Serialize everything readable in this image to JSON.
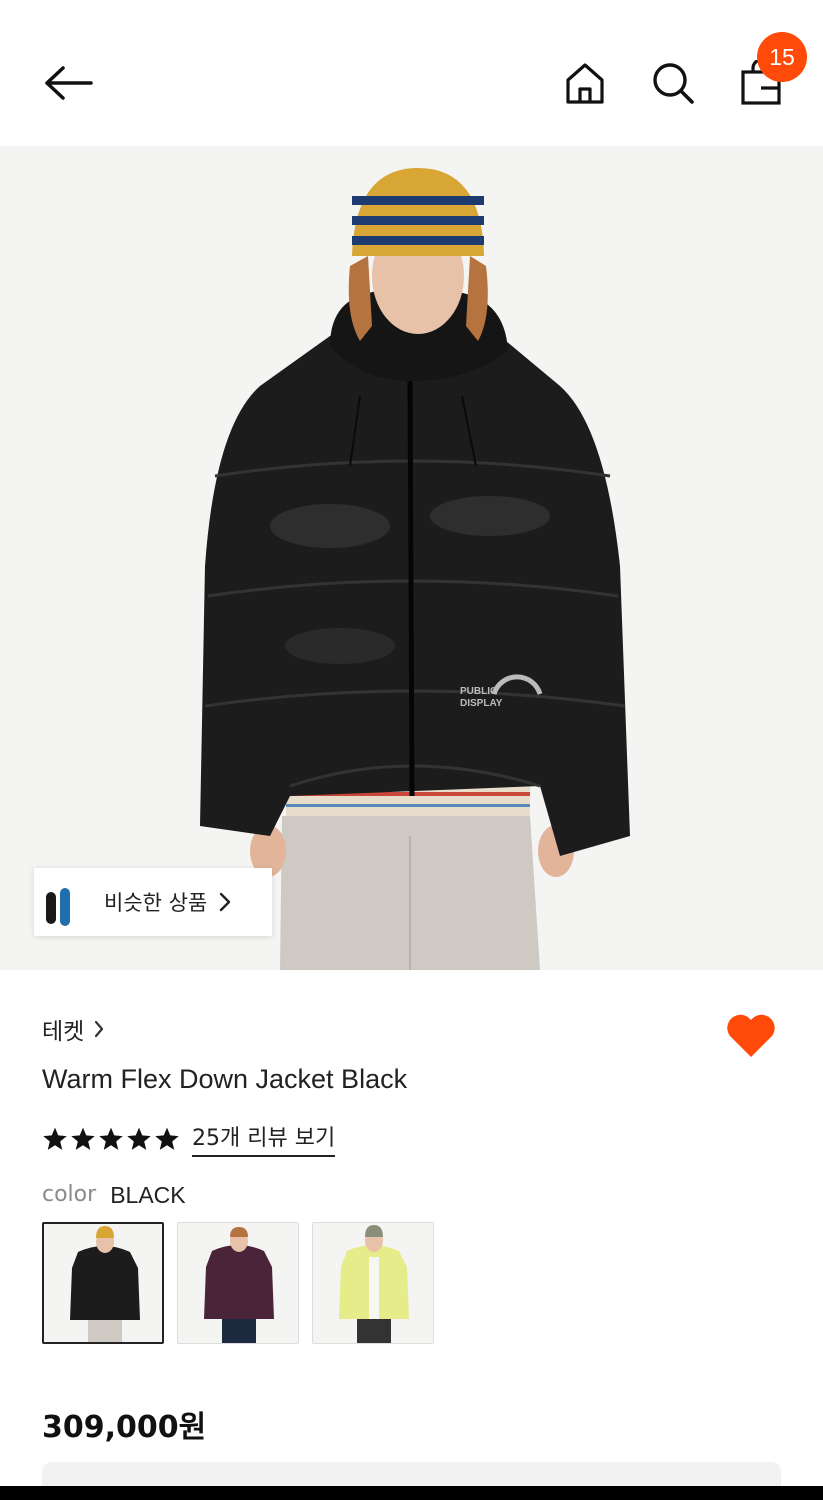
{
  "header": {
    "cart_count": "15",
    "icons": [
      "back-arrow-icon",
      "home-icon",
      "search-icon",
      "shopping-bag-icon"
    ]
  },
  "similar": {
    "label": "비슷한 상품"
  },
  "product": {
    "brand": "테켓",
    "title": "Warm Flex Down Jacket Black",
    "rating_stars": 5,
    "review_link": "25개 리뷰 보기",
    "color_label": "color",
    "color_value": "BLACK",
    "swatch_colors": [
      "#1c1c1c",
      "#4a2438",
      "#e6ec8a"
    ],
    "price": "309,000원"
  },
  "colors": {
    "accent": "#ff4a0a",
    "text": "#222222",
    "muted": "#8a8a8a"
  }
}
